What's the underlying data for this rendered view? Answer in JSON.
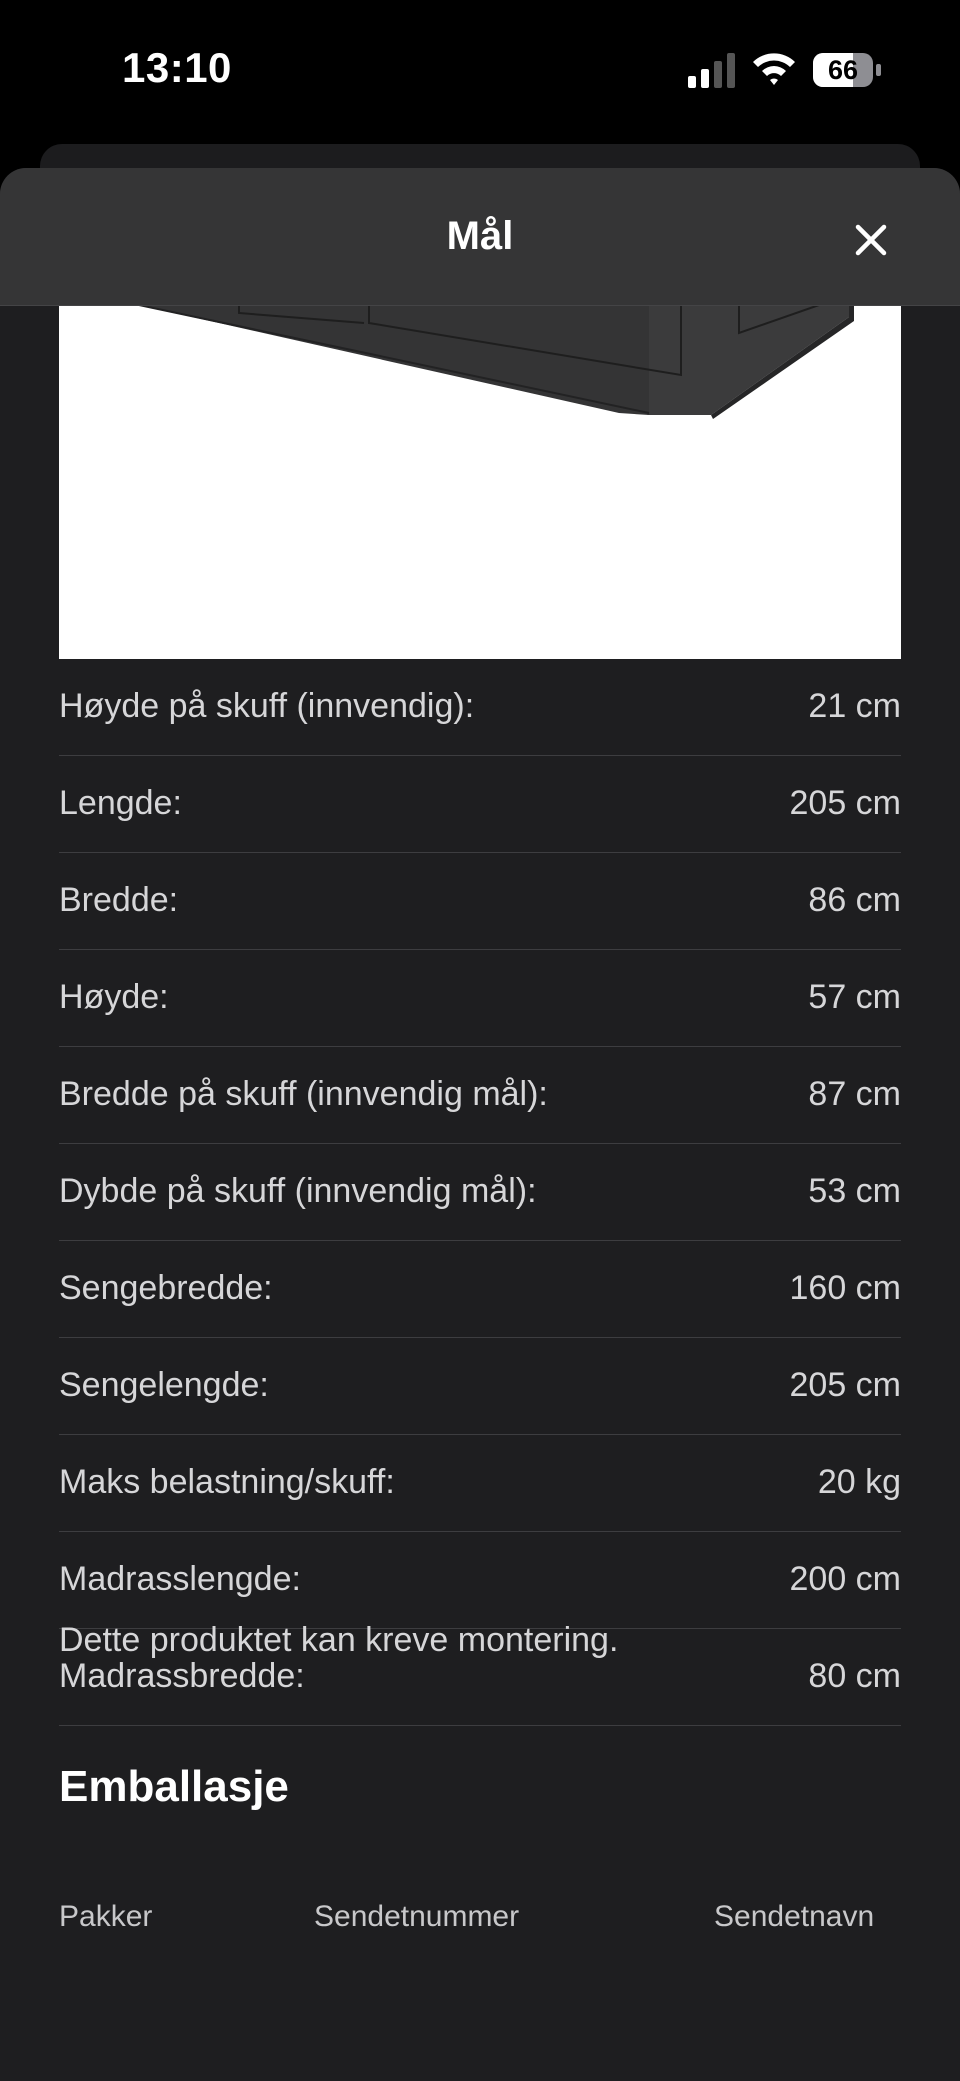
{
  "status_bar": {
    "time": "13:10",
    "battery": "66",
    "icons": [
      "signal-icon",
      "wifi-icon",
      "battery-icon"
    ]
  },
  "sheet": {
    "title": "Mål",
    "close_icon": "close-icon"
  },
  "product_image": {
    "icon": "bed-frame-illustration"
  },
  "specs": [
    {
      "label": "Høyde på skuff (innvendig):",
      "value": "21 cm"
    },
    {
      "label": "Lengde:",
      "value": "205 cm"
    },
    {
      "label": "Bredde:",
      "value": "86 cm"
    },
    {
      "label": "Høyde:",
      "value": "57 cm"
    },
    {
      "label": "Bredde på skuff (innvendig mål):",
      "value": "87 cm"
    },
    {
      "label": "Dybde på skuff (innvendig mål):",
      "value": "53 cm"
    },
    {
      "label": "Sengebredde:",
      "value": "160 cm"
    },
    {
      "label": "Sengelengde:",
      "value": "205 cm"
    },
    {
      "label": "Maks belastning/skuff:",
      "value": "20 kg"
    },
    {
      "label": "Madrasslengde:",
      "value": "200 cm"
    },
    {
      "label": "Madrassbredde:",
      "value": "80 cm"
    }
  ],
  "assembly_note": "Dette produktet kan kreve montering.",
  "packaging": {
    "heading": "Emballasje",
    "columns": [
      "Pakker",
      "Sendetnummer",
      "Sendetnavn"
    ]
  },
  "colors": {
    "background": "#000000",
    "sheet": "#1e1e20",
    "header": "#353536",
    "text": "#d6d6d8",
    "divider": "#3d3d40"
  }
}
